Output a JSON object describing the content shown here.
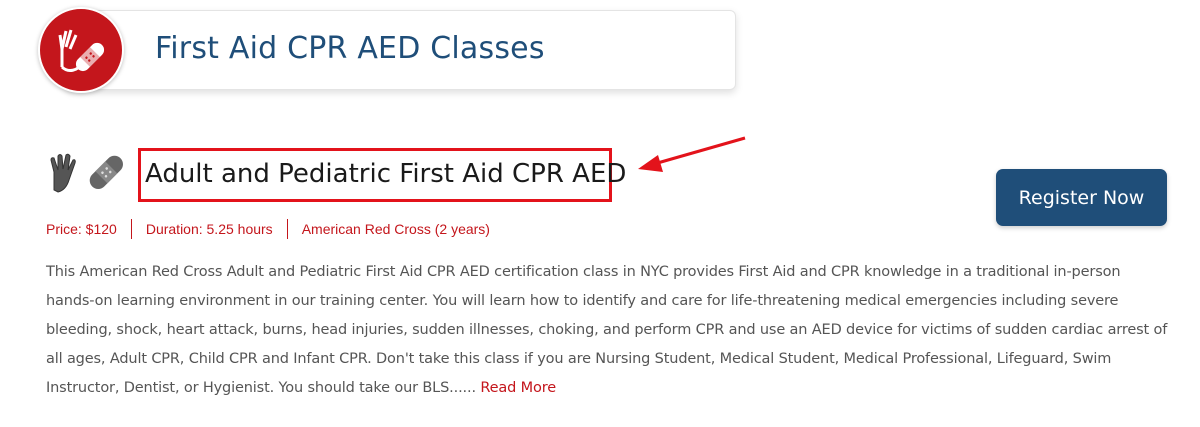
{
  "header": {
    "title": "First Aid CPR AED Classes",
    "icon": "hand-and-bandage-icon",
    "badge_color": "#c4161c"
  },
  "course": {
    "title": "Adult and Pediatric First Aid CPR AED",
    "icons": [
      "hand-icon",
      "bandage-icon"
    ],
    "price": "Price: $120",
    "duration": "Duration: 5.25 hours",
    "certification": "American Red Cross (2 years)",
    "description": "This American Red Cross Adult and Pediatric First Aid CPR AED certification class in NYC provides First Aid and CPR knowledge in a traditional in-person hands-on learning environment in our training center. You will learn how to identify and care for life-threatening medical emergencies including severe bleeding, shock, heart attack, burns, head injuries, sudden illnesses, choking, and perform CPR and use an AED device for victims of sudden cardiac arrest of all ages, Adult CPR, Child CPR and Infant CPR. Don't take this class if you are Nursing Student, Medical Student, Medical Professional, Lifeguard, Swim Instructor, Dentist, or Hygienist. You should take our BLS......",
    "read_more": "Read More",
    "register_label": "Register Now"
  },
  "colors": {
    "accent_red": "#c4161c",
    "navy": "#1f4e79",
    "highlight": "#e3131b"
  }
}
